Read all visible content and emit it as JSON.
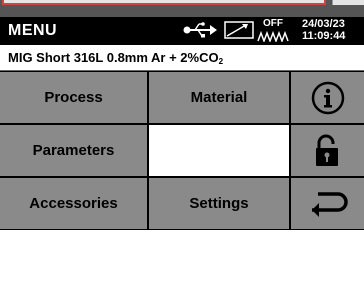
{
  "status_bar": {
    "title": "MENU",
    "connection_icon": "usb-icon",
    "trend_icon": "trend-chart-icon",
    "arc_state": "OFF",
    "arc_icon": "arc-wave-icon",
    "date": "24/03/23",
    "time": "11:09:44"
  },
  "program": {
    "text_prefix": "MIG Short  316L  0.8mm  Ar + 2%CO",
    "subscript": "2"
  },
  "menu": {
    "process": "Process",
    "material": "Material",
    "parameters": "Parameters",
    "accessories": "Accessories",
    "settings": "Settings",
    "info_icon": "info-icon",
    "lock_icon": "unlock-icon",
    "back_icon": "back-arrow-icon"
  },
  "colors": {
    "header_bg": "#000000",
    "button_bg": "#8a8a8a",
    "grid_line": "#000000"
  }
}
